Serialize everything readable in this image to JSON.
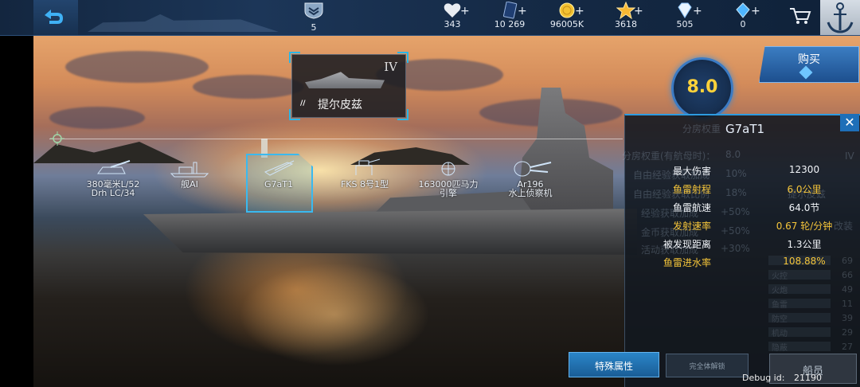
{
  "topbar": {
    "rank": "5",
    "resources": [
      {
        "name": "heart-icon",
        "value": "343"
      },
      {
        "name": "card-icon",
        "value": "10 269"
      },
      {
        "name": "coin-icon",
        "value": "96005K"
      },
      {
        "name": "star-icon",
        "value": "3618"
      },
      {
        "name": "diamond-icon",
        "value": "505"
      },
      {
        "name": "crystal-icon",
        "value": "0"
      }
    ],
    "plus": "+"
  },
  "ship_card": {
    "tier": "IV",
    "name": "提尔皮兹",
    "class_icon": "//"
  },
  "rating": "8.0",
  "buy": {
    "label": "购买"
  },
  "modules": [
    {
      "label": "380毫米L/52",
      "sub": "Drh LC/34"
    },
    {
      "label": "舰AI",
      "sub": ""
    },
    {
      "label": "G7aT1",
      "sub": ""
    },
    {
      "label": "FKS 8号1型",
      "sub": ""
    },
    {
      "label": "163000匹马力",
      "sub": "引擎"
    },
    {
      "label": "Ar196",
      "sub": "水上侦察机"
    }
  ],
  "panel": {
    "title": "G7aT1",
    "close": "✕",
    "stats": [
      {
        "label": "最大伤害",
        "value": "12300",
        "style": "white"
      },
      {
        "label": "鱼雷射程",
        "value": "6.0公里",
        "style": "gold"
      },
      {
        "label": "鱼雷航速",
        "value": "64.0节",
        "style": "white"
      },
      {
        "label": "发射速率",
        "value": "0.67 轮/分钟",
        "style": "gold"
      },
      {
        "label": "被发现距离",
        "value": "1.3公里",
        "style": "white"
      },
      {
        "label": "鱼雷进水率",
        "value": "108.88%",
        "style": "gold"
      }
    ],
    "background": {
      "lines": [
        "分房权重",
        "分房权重(有航母时)：",
        "自由经验获取加成",
        "自由经验获取比例",
        "经验获取加成",
        "金币获取加成",
        "活动获取加成",
        "自由经验获取比例：",
        "提尔皮兹",
        "IV",
        "改装"
      ],
      "values": [
        "8.0",
        "10%",
        "18%",
        "+50%",
        "+50%",
        "+30%"
      ],
      "attrs": [
        {
          "label": "火控",
          "num": "66"
        },
        {
          "label": "火炮",
          "num": "49"
        },
        {
          "label": "鱼雷",
          "num": "11"
        },
        {
          "label": "防空",
          "num": "39"
        },
        {
          "label": "机动",
          "num": "29"
        },
        {
          "label": "隐蔽",
          "num": "27"
        }
      ],
      "top_num": "69"
    }
  },
  "buttons": {
    "special": "特殊属性",
    "unlock": "完全体解锁",
    "crew": "船员"
  },
  "debug": {
    "label": "Debug id:",
    "id": "21190"
  },
  "colors": {
    "accent": "#2d9be0",
    "gold": "#f5c53a",
    "rating": "#ffd23a"
  }
}
